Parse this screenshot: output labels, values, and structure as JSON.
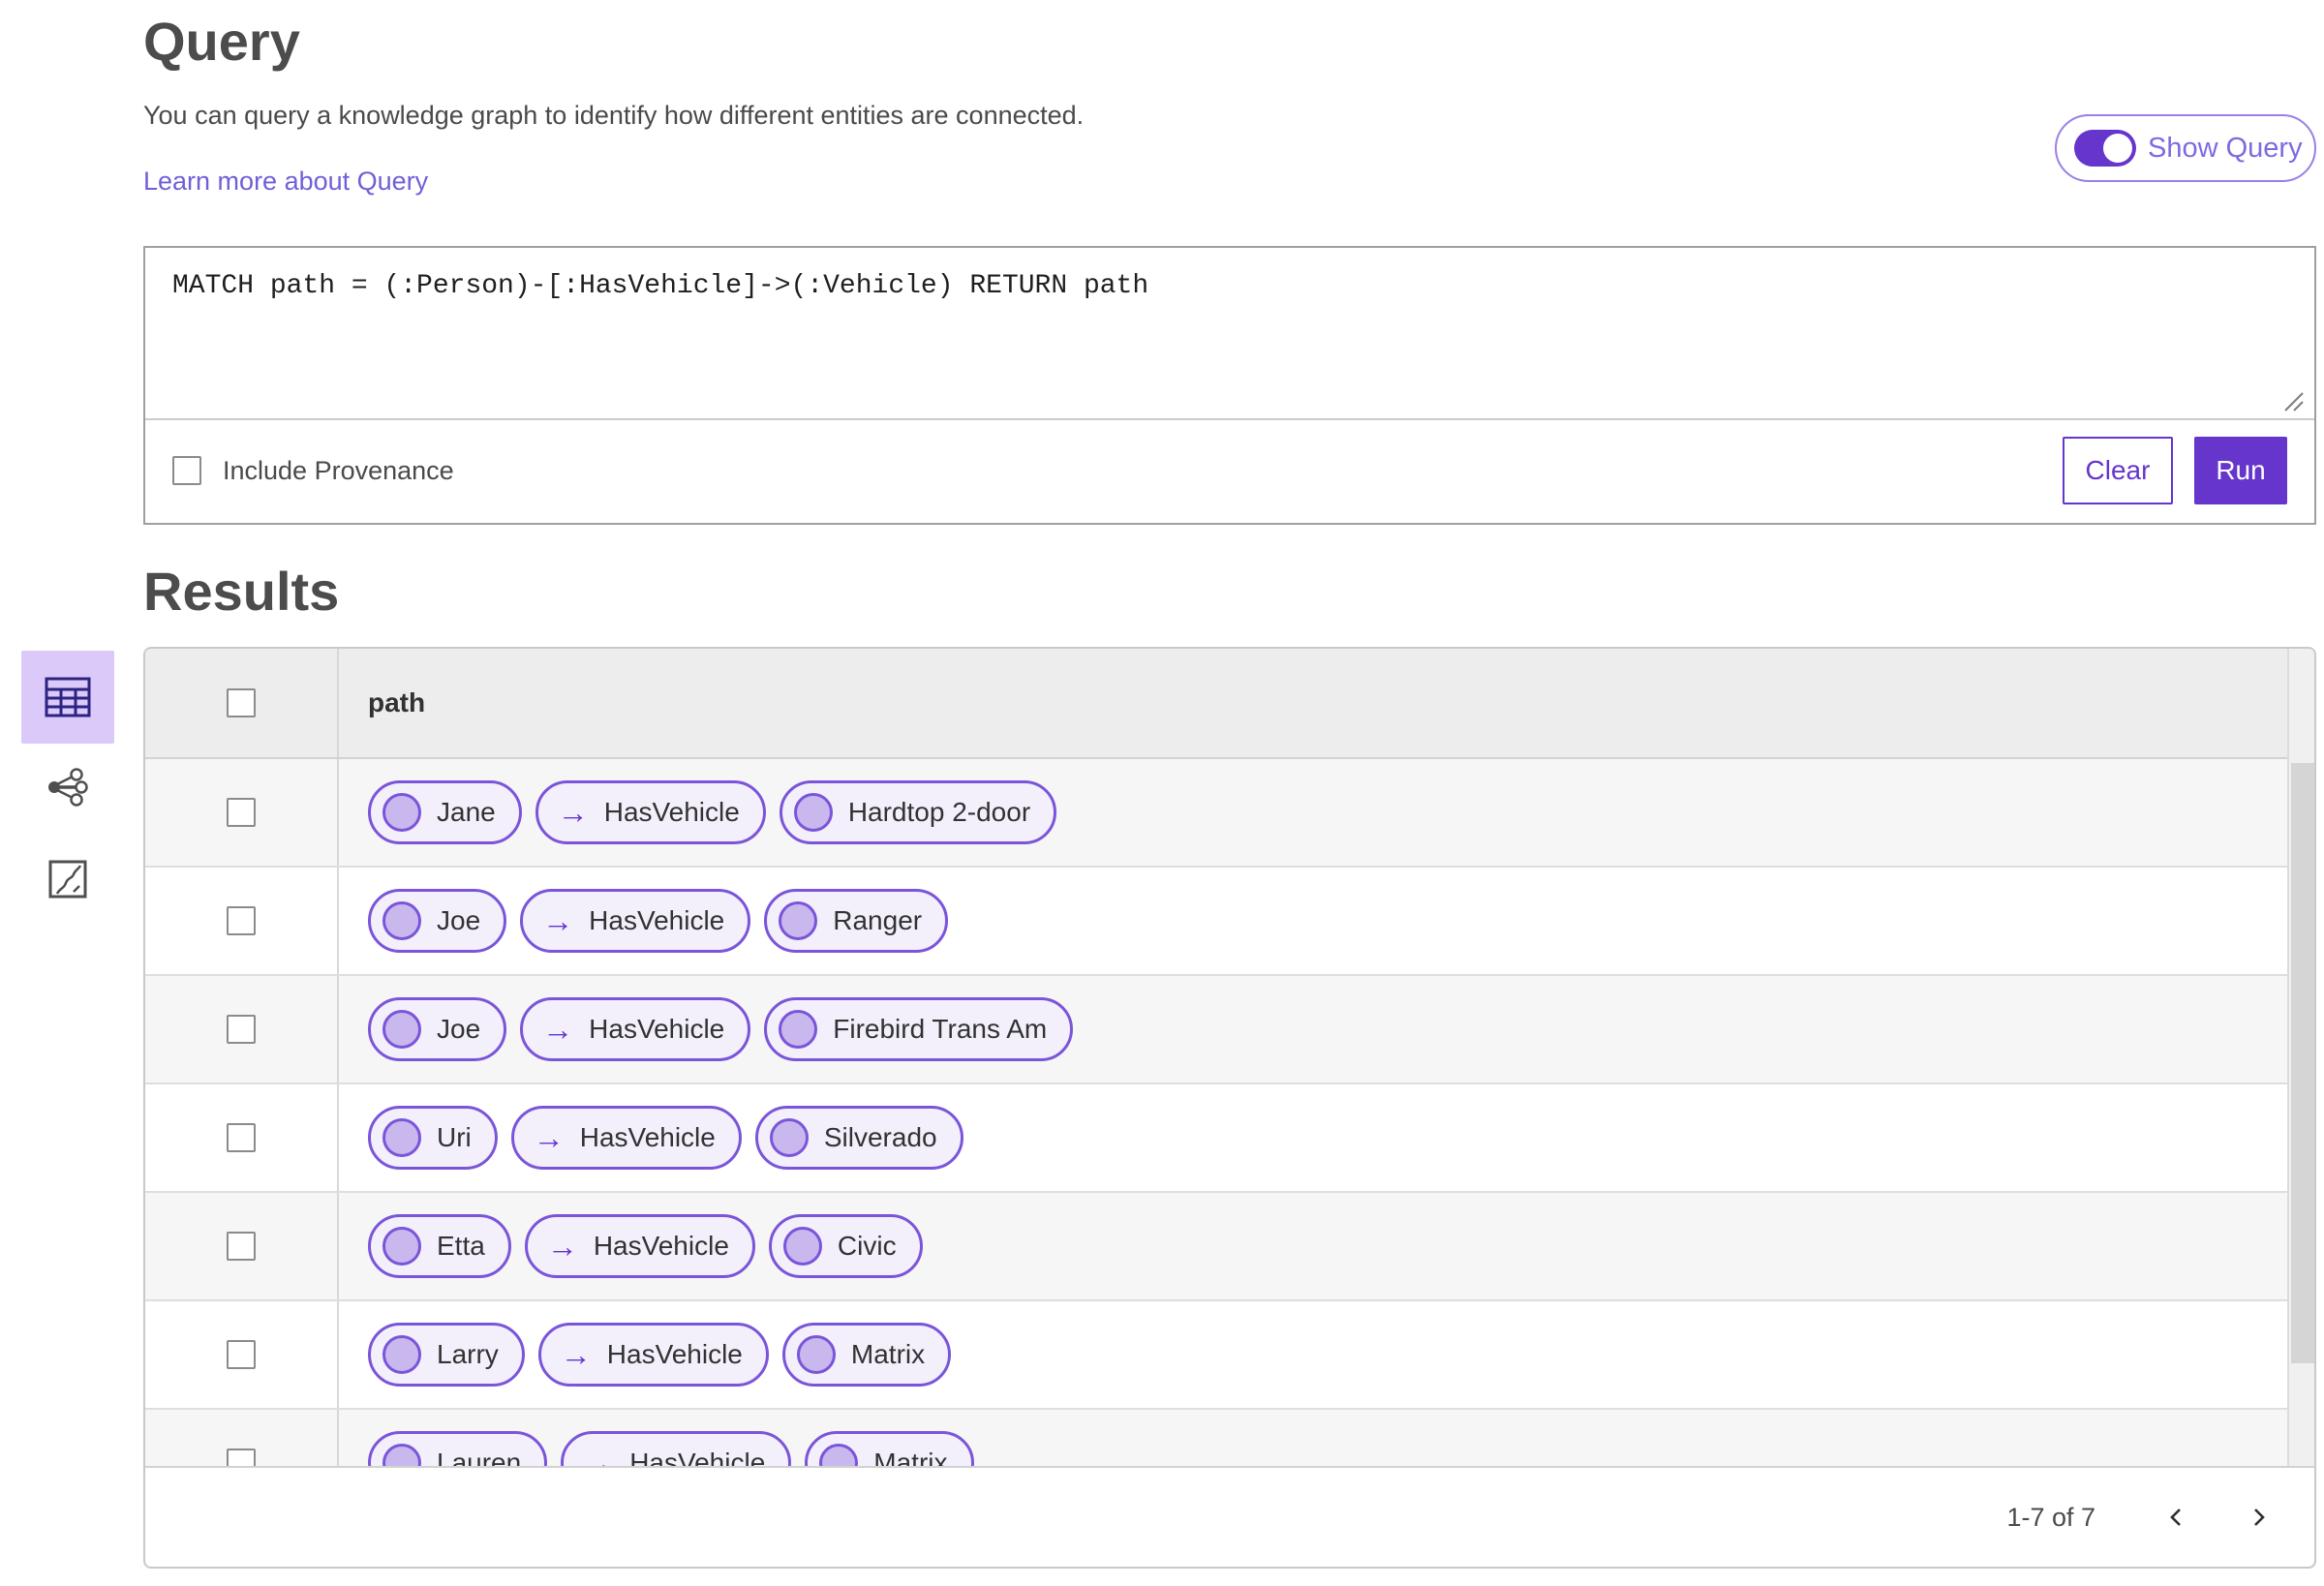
{
  "query_panel": {
    "title": "Query",
    "description": "You can query a knowledge graph to identify how different entities are connected.",
    "learn_more_link": "Learn more about Query",
    "show_query_label": "Show Query",
    "query_text": "MATCH path = (:Person)-[:HasVehicle]->(:Vehicle) RETURN path",
    "include_provenance_label": "Include Provenance",
    "clear_button": "Clear",
    "run_button": "Run"
  },
  "results_panel": {
    "title": "Results",
    "column_header": "path",
    "arrow_glyph": "→",
    "rows": [
      {
        "source": "Jane",
        "relation": "HasVehicle",
        "target": "Hardtop 2-door"
      },
      {
        "source": "Joe",
        "relation": "HasVehicle",
        "target": "Ranger"
      },
      {
        "source": "Joe",
        "relation": "HasVehicle",
        "target": "Firebird Trans Am"
      },
      {
        "source": "Uri",
        "relation": "HasVehicle",
        "target": "Silverado"
      },
      {
        "source": "Etta",
        "relation": "HasVehicle",
        "target": "Civic"
      },
      {
        "source": "Larry",
        "relation": "HasVehicle",
        "target": "Matrix"
      },
      {
        "source": "Lauren",
        "relation": "HasVehicle",
        "target": "Matrix"
      }
    ],
    "pagination": {
      "range_label": "1-7 of 7"
    }
  },
  "view_switcher": {
    "items": [
      {
        "name": "table-view",
        "icon": "table-icon",
        "selected": true
      },
      {
        "name": "graph-view",
        "icon": "graph-icon",
        "selected": false
      },
      {
        "name": "map-view",
        "icon": "map-icon",
        "selected": false
      }
    ]
  },
  "colors": {
    "accent": "#6535cc",
    "accent_light": "#dbc9f9",
    "pill_border": "#7a55d9",
    "pill_background": "#f3f0fc",
    "pill_circle": "#c9b8ee",
    "link": "#6f5fd8"
  }
}
